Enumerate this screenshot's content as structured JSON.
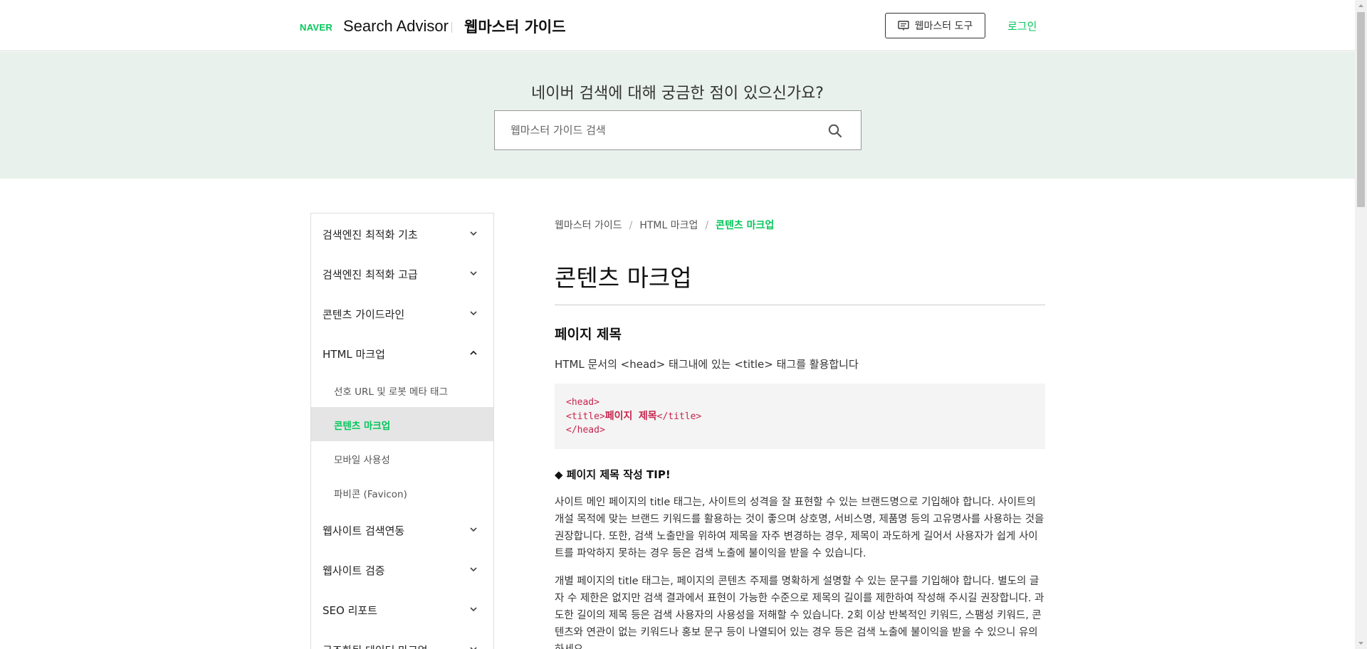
{
  "header": {
    "logo": "NAVER",
    "brand": "Search Advisor",
    "guide_title": "웹마스터 가이드",
    "tool_button": "웹마스터 도구",
    "login": "로그인"
  },
  "hero": {
    "question": "네이버 검색에 대해 궁금한 점이 있으신가요?",
    "search_placeholder": "웹마스터 가이드 검색"
  },
  "sidebar": {
    "items": [
      {
        "label": "검색엔진 최적화 기초",
        "expanded": false
      },
      {
        "label": "검색엔진 최적화 고급",
        "expanded": false
      },
      {
        "label": "콘텐츠 가이드라인",
        "expanded": false
      },
      {
        "label": "HTML 마크업",
        "expanded": true
      },
      {
        "label": "웹사이트 검색연동",
        "expanded": false
      },
      {
        "label": "웹사이트 검증",
        "expanded": false
      },
      {
        "label": "SEO 리포트",
        "expanded": false
      },
      {
        "label": "구조화된 데이터 마크업",
        "expanded": false
      }
    ],
    "subitems": [
      {
        "label": "선호 URL 및 로봇 메타 태그",
        "active": false
      },
      {
        "label": "콘텐츠 마크업",
        "active": true
      },
      {
        "label": "모바일 사용성",
        "active": false
      },
      {
        "label": "파비콘 (Favicon)",
        "active": false
      }
    ]
  },
  "breadcrumb": {
    "items": [
      "웹마스터 가이드",
      "HTML 마크업"
    ],
    "current": "콘텐츠 마크업",
    "separator": "/"
  },
  "content": {
    "title": "콘텐츠 마크업",
    "section_heading": "페이지 제목",
    "intro": "HTML 문서의 <head> 태그내에 있는 <title> 태그를 활용합니다",
    "code": {
      "line1": "<head>",
      "line2_open": "<title>",
      "line2_text": "페이지 제목",
      "line2_close": "</title>",
      "line3": "</head>"
    },
    "tip_heading": "◆ 페이지 제목 작성 TIP!",
    "paragraph1": "사이트 메인 페이지의 title 태그는, 사이트의 성격을 잘 표현할 수 있는 브랜드명으로 기입해야 합니다. 사이트의 개설 목적에 맞는 브랜드 키워드를 활용하는 것이 좋으며 상호명, 서비스명, 제품명 등의 고유명사를 사용하는 것을 권장합니다. 또한, 검색 노출만을 위하여 제목을 자주 변경하는 경우, 제목이 과도하게 길어서 사용자가 쉽게 사이트를 파악하지 못하는 경우 등은 검색 노출에 불이익을 받을 수 있습니다.",
    "paragraph2": "개별 페이지의 title 태그는, 페이지의 콘텐츠 주제를 명확하게 설명할 수 있는 문구를 기입해야 합니다. 별도의 글자 수 제한은 없지만 검색 결과에서 표현이 가능한 수준으로 제목의 길이를 제한하여 작성해 주시길 권장합니다. 과도한 길이의 제목 등은 검색 사용자의 사용성을 저해할 수 있습니다. 2회 이상 반복적인 키워드, 스팸성 키워드, 콘텐츠와 연관이 없는 키워드나 홍보 문구 등이 나열되어 있는 경우 등은 검색 노출에 불이익을 받을 수 있으니 유의하세요."
  },
  "colors": {
    "accent": "#03c75a",
    "hero_bg": "#e8f1ec",
    "code_text": "#c7254e"
  }
}
